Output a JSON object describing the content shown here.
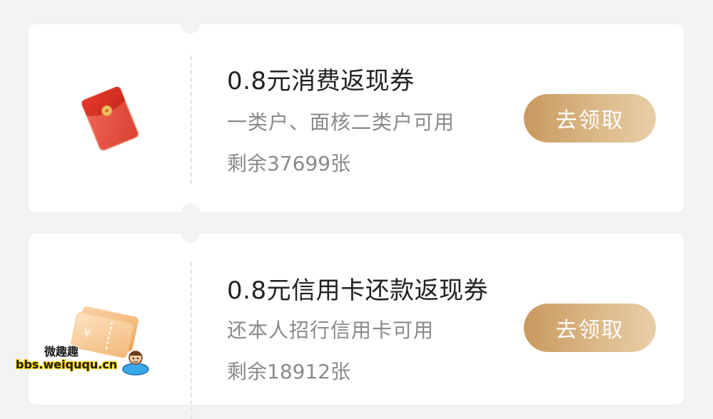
{
  "coupons": [
    {
      "icon": "red-envelope-icon",
      "title": "0.8元消费返现券",
      "description": "一类户、面核二类户可用",
      "remaining": "剩余37699张",
      "button_label": "去领取"
    },
    {
      "icon": "ticket-stack-icon",
      "title": "0.8元信用卡还款返现券",
      "description": "还本人招行信用卡可用",
      "remaining": "剩余18912张",
      "button_label": "去领取"
    }
  ],
  "watermark": {
    "site_name": "微趣趣",
    "url": "bbs.weiququ.cn"
  },
  "colors": {
    "button_gradient_start": "#c9995f",
    "button_gradient_end": "#e8cfa8",
    "title": "#222222",
    "secondary_text": "#8a8a8a",
    "background": "#f3f3f3"
  }
}
